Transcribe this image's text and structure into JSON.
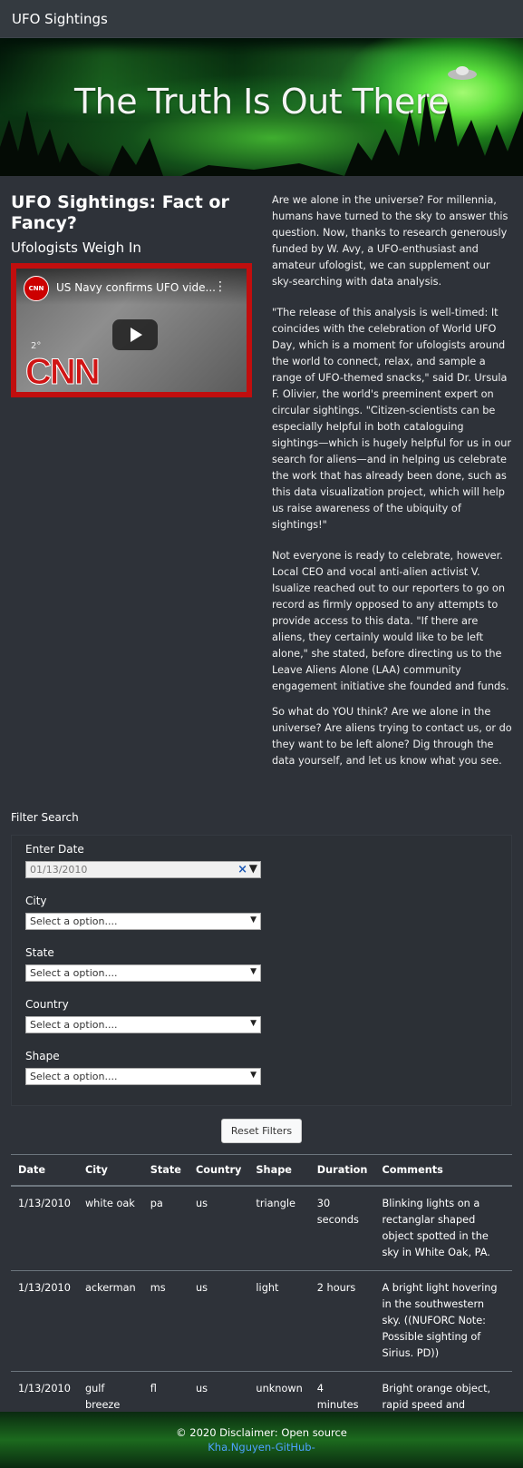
{
  "navbar": {
    "brand": "UFO Sightings"
  },
  "hero": {
    "headline": "The Truth Is Out There"
  },
  "intro": {
    "heading": "UFO Sightings: Fact or Fancy?",
    "subheading": "Ufologists Weigh In",
    "video": {
      "channel_badge": "CNN",
      "title": "US Navy confirms UFO vide...",
      "logo_text": "CNN",
      "overlay_text": "2°"
    },
    "paragraphs": [
      "Are we alone in the universe? For millennia, humans have turned to the sky to answer this question. Now, thanks to research generously funded by W. Avy, a UFO-enthusiast and amateur ufologist, we can supplement our sky-searching with data analysis.",
      "\"The release of this analysis is well-timed: It coincides with the celebration of World UFO Day, which is a moment for ufologists around the world to connect, relax, and sample a range of UFO-themed snacks,\" said Dr. Ursula F. Olivier, the world's preeminent expert on circular sightings. \"Citizen-scientists can be especially helpful in both cataloguing sightings—which is hugely helpful for us in our search for aliens—and in helping us celebrate the work that has already been done, such as this data visualization project, which will help us raise awareness of the ubiquity of sightings!\"",
      "Not everyone is ready to celebrate, however. Local CEO and vocal anti-alien activist V. Isualize reached out to our reporters to go on record as firmly opposed to any attempts to provide access to this data. \"If there are aliens, they certainly would like to be left alone,\" she stated, before directing us to the Leave Aliens Alone (LAA) community engagement initiative she founded and funds.",
      "So what do YOU think? Are we alone in the universe? Are aliens trying to contact us, or do they want to be left alone? Dig through the data yourself, and let us know what you see."
    ]
  },
  "filters": {
    "title": "Filter Search",
    "date": {
      "label": "Enter Date",
      "value": "01/13/2010"
    },
    "city": {
      "label": "City",
      "value": "Select a option...."
    },
    "state": {
      "label": "State",
      "value": "Select a option...."
    },
    "country": {
      "label": "Country",
      "value": "Select a option...."
    },
    "shape": {
      "label": "Shape",
      "value": "Select a option...."
    },
    "reset_label": "Reset Filters"
  },
  "table": {
    "headers": [
      "Date",
      "City",
      "State",
      "Country",
      "Shape",
      "Duration",
      "Comments"
    ],
    "rows": [
      [
        "1/13/2010",
        "white oak",
        "pa",
        "us",
        "triangle",
        "30 seconds",
        "Blinking lights on a rectanglar shaped object spotted in the sky in White Oak, PA."
      ],
      [
        "1/13/2010",
        "ackerman",
        "ms",
        "us",
        "light",
        "2 hours",
        "A bright light hovering in the southwestern sky. ((NUFORC Note: Possible sighting of Sirius. PD))"
      ],
      [
        "1/13/2010",
        "gulf breeze",
        "fl",
        "us",
        "unknown",
        "4 minutes",
        "Bright orange object, rapid speed and direction changes .."
      ]
    ]
  },
  "footer": {
    "text": "© 2020 Disclaimer: Open source",
    "link": "Kha.Nguyen-GitHub-"
  },
  "colors": {
    "background": "#2e3239",
    "navbar": "#343a40",
    "video_border": "#c10e0e",
    "link": "#4da3ff"
  }
}
